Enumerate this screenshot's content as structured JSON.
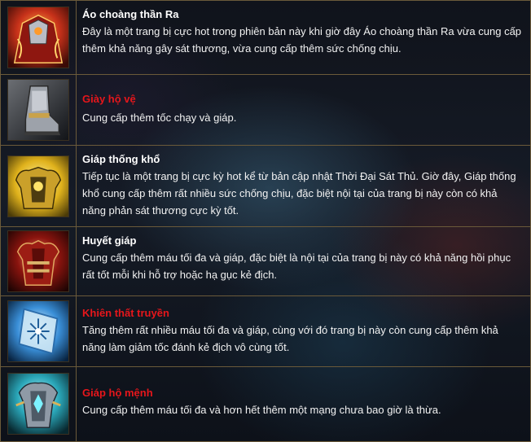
{
  "items": [
    {
      "name": "Áo choàng thần Ra",
      "name_color": "#ffffff",
      "icon": "red-cloak-armor-icon",
      "description": "Đây là một trang bị cực hot trong phiên bản này khi giờ đây Áo choàng thần Ra vừa cung cấp thêm khả năng gây sát thương, vừa cung cấp thêm sức chống chịu."
    },
    {
      "name": "Giày hộ vệ",
      "name_color": "#e6161b",
      "icon": "armored-boots-icon",
      "description": "Cung cấp thêm tốc chạy và giáp."
    },
    {
      "name": "Giáp thống khổ",
      "name_color": "#ffffff",
      "icon": "golden-armor-icon",
      "description": "Tiếp tục là một trang bị cực kỳ hot kể từ bản cập nhật Thời Đại Sát Thủ. Giờ đây, Giáp thống khổ cung cấp thêm rất nhiều sức chống chịu, đặc biệt nội tại của trang bị này còn có khả năng phản sát thương cực kỳ tốt."
    },
    {
      "name": "Huyết giáp",
      "name_color": "#ffffff",
      "icon": "blood-armor-icon",
      "description": "Cung cấp thêm máu tối đa và giáp, đặc biệt là nội tại của trang bị này có khả năng hồi phục rất tốt mỗi khi hỗ trợ hoặc hạ gục kẻ địch."
    },
    {
      "name": "Khiên thất truyền",
      "name_color": "#e6161b",
      "icon": "frost-shield-icon",
      "description": "Tăng thêm rất nhiều máu tối đa và giáp, cùng với đó trang bị này còn cung cấp thêm khả năng làm giảm tốc đánh kẻ địch vô cùng tốt."
    },
    {
      "name": "Giáp hộ mệnh",
      "name_color": "#e6161b",
      "icon": "guardian-armor-icon",
      "description": "Cung cấp thêm máu tối đa và hơn hết thêm một mạng chưa bao giờ là thừa."
    }
  ]
}
